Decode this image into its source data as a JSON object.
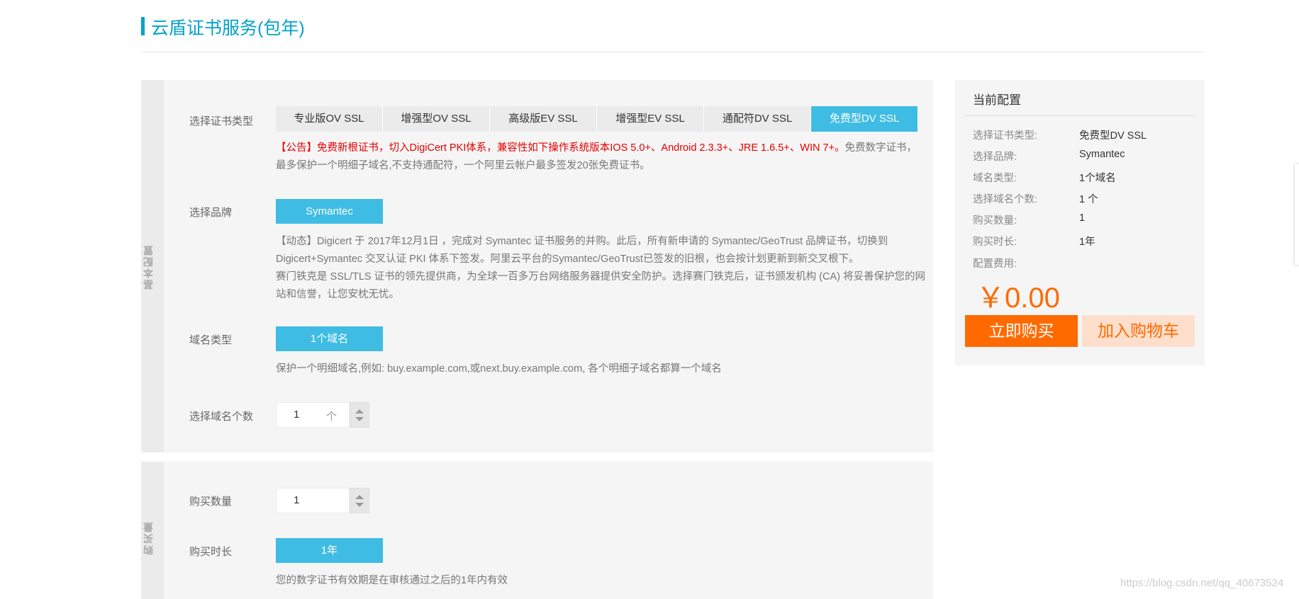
{
  "page": {
    "title": "云盾证书服务(包年)"
  },
  "basic": {
    "side_label": "基本配置",
    "cert_type": {
      "label": "选择证书类型",
      "options": [
        "专业版OV SSL",
        "增强型OV SSL",
        "高级版EV SSL",
        "增强型EV SSL",
        "通配符DV SSL",
        "免费型DV SSL"
      ],
      "selected": "免费型DV SSL"
    },
    "notice_red": "【公告】免费新根证书，切入DigiCert PKI体系，兼容性如下操作系统版本IOS 5.0+、Android 2.3.3+、JRE 1.6.5+、WIN 7+。",
    "notice_gray": "免费数字证书，最多保护一个明细子域名,不支持通配符，一个阿里云帐户最多签发20张免费证书。",
    "brand": {
      "label": "选择品牌",
      "value": "Symantec",
      "desc1": "【动态】Digicert 于 2017年12月1日 ，完成对 Symantec 证书服务的并购。此后，所有新申请的 Symantec/GeoTrust 品牌证书，切换到 Digicert+Symantec 交叉认证 PKI 体系下签发。阿里云平台的Symantec/GeoTrust已签发的旧根，也会按计划更新到新交叉根下。",
      "desc2": "赛门铁克是 SSL/TLS 证书的领先提供商，为全球一百多万台网络服务器提供安全防护。选择赛门铁克后，证书颁发机构 (CA) 将妥善保护您的网站和信誉，让您安枕无忧。"
    },
    "domain_type": {
      "label": "域名类型",
      "value": "1个域名",
      "desc": "保护一个明细域名,例如: buy.example.com,或next.buy.example.com, 各个明细子域名都算一个域名"
    },
    "domain_count": {
      "label": "选择域名个数",
      "value": "1",
      "unit": "个"
    }
  },
  "buy": {
    "side_label": "购买量",
    "quantity": {
      "label": "购买数量",
      "value": "1"
    },
    "duration": {
      "label": "购买时长",
      "value": "1年",
      "desc": "您的数字证书有效期是在审核通过之后的1年内有效"
    }
  },
  "summary": {
    "title": "当前配置",
    "rows": [
      {
        "k": "选择证书类型:",
        "v": "免费型DV SSL"
      },
      {
        "k": "选择品牌:",
        "v": "Symantec"
      },
      {
        "k": "域名类型:",
        "v": "1个域名"
      },
      {
        "k": "选择域名个数:",
        "v": "1 个"
      },
      {
        "k": "购买数量:",
        "v": "1"
      },
      {
        "k": "购买时长:",
        "v": "1年"
      },
      {
        "k": "配置费用:",
        "v": ""
      }
    ],
    "price": "￥0.00",
    "buy_now": "立即购买",
    "add_cart": "加入购物车"
  },
  "watermark": "https://blog.csdn.net/qq_40673524",
  "colors": {
    "accent": "#3fbce3",
    "title": "#00a2ca",
    "orange": "#ff6a00",
    "notice_red": "#e60000"
  }
}
